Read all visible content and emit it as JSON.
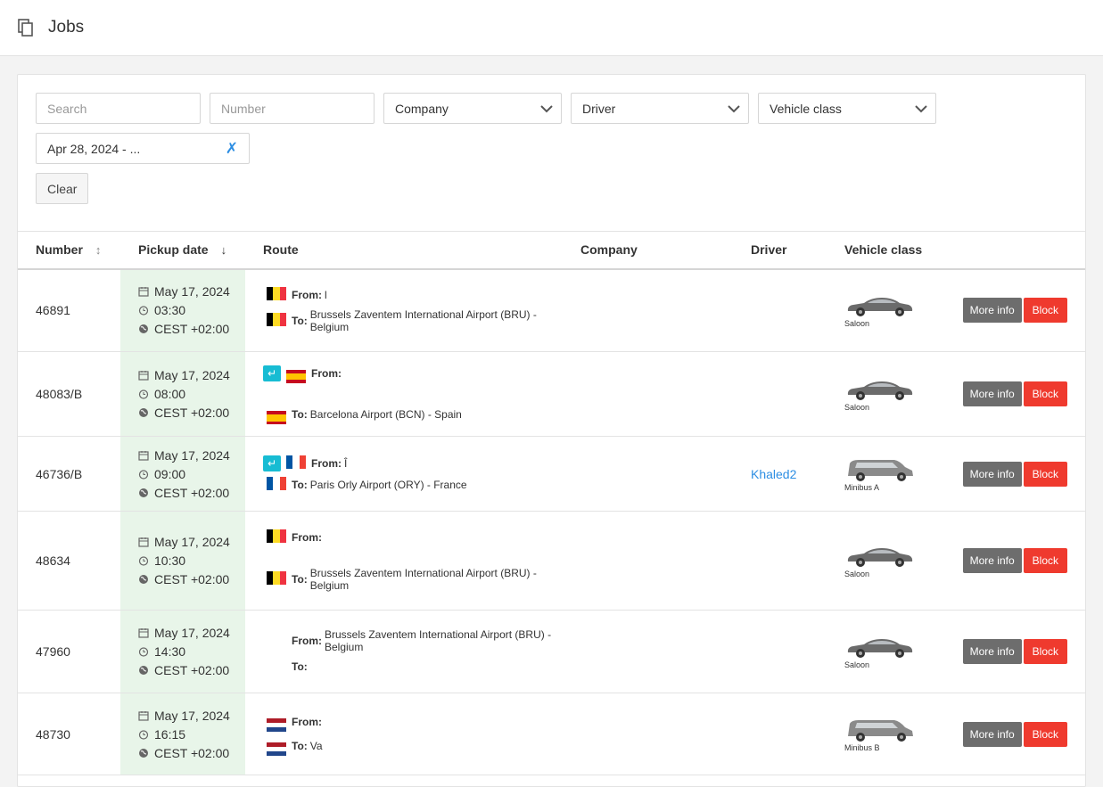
{
  "header": {
    "title": "Jobs",
    "icon": "copy-icon"
  },
  "filters": {
    "search_placeholder": "Search",
    "number_placeholder": "Number",
    "company_label": "Company",
    "driver_label": "Driver",
    "vehicle_class_label": "Vehicle class",
    "date_range_value": "Apr 28, 2024 - ...",
    "date_clear_glyph": "✗",
    "clear_label": "Clear"
  },
  "table": {
    "columns": {
      "number": "Number",
      "pickup_date": "Pickup date",
      "route": "Route",
      "company": "Company",
      "driver": "Driver",
      "vehicle_class": "Vehicle class"
    },
    "sort_number_glyph": "↕",
    "sort_pickup_glyph": "↓",
    "more_info_label": "More info",
    "block_label": "Block",
    "from_label": "From:",
    "to_label": "To:",
    "rows": [
      {
        "number": "46891",
        "date": "May 17, 2024",
        "time": "03:30",
        "tz": "CEST +02:00",
        "from_flag": "be",
        "from": "l",
        "return": false,
        "to_flag": "be",
        "to": "Brussels Zaventem International Airport (BRU) - Belgium",
        "company": "",
        "driver": "",
        "vehicle_class": "Saloon",
        "car": "saloon"
      },
      {
        "number": "48083/B",
        "date": "May 17, 2024",
        "time": "08:00",
        "tz": "CEST +02:00",
        "from_flag": "es",
        "from": "",
        "return": true,
        "to_flag": "es",
        "to": "Barcelona Airport (BCN) - Spain",
        "company": "",
        "driver": "",
        "vehicle_class": "Saloon",
        "car": "saloon"
      },
      {
        "number": "46736/B",
        "date": "May 17, 2024",
        "time": "09:00",
        "tz": "CEST +02:00",
        "from_flag": "fr",
        "from": "Î",
        "return": true,
        "to_flag": "fr",
        "to": "Paris Orly Airport (ORY) - France",
        "company": "",
        "driver": "Khaled2",
        "vehicle_class": "Minibus A",
        "car": "minibus"
      },
      {
        "number": "48634",
        "date": "May 17, 2024",
        "time": "10:30",
        "tz": "CEST +02:00",
        "from_flag": "be",
        "from": "",
        "return": false,
        "to_flag": "be",
        "to": "Brussels Zaventem International Airport (BRU) - Belgium",
        "company": "",
        "driver": "",
        "vehicle_class": "Saloon",
        "car": "saloon"
      },
      {
        "number": "47960",
        "date": "May 17, 2024",
        "time": "14:30",
        "tz": "CEST +02:00",
        "from_flag": "",
        "from": "Brussels Zaventem International Airport (BRU) - Belgium",
        "return": false,
        "to_flag": "",
        "to": "",
        "company": "",
        "driver": "",
        "vehicle_class": "Saloon",
        "car": "saloon"
      },
      {
        "number": "48730",
        "date": "May 17, 2024",
        "time": "16:15",
        "tz": "CEST +02:00",
        "from_flag": "nl",
        "from": "",
        "return": false,
        "to_flag": "nl",
        "to": "Va",
        "company": "",
        "driver": "",
        "vehicle_class": "Minibus B",
        "car": "minibus"
      }
    ]
  },
  "colors": {
    "pickup_bg": "#e8f5e9",
    "more_info_bg": "#6d6d6d",
    "block_bg": "#ef3a2e",
    "link": "#2d8ee3",
    "return_badge": "#17bcd3"
  }
}
